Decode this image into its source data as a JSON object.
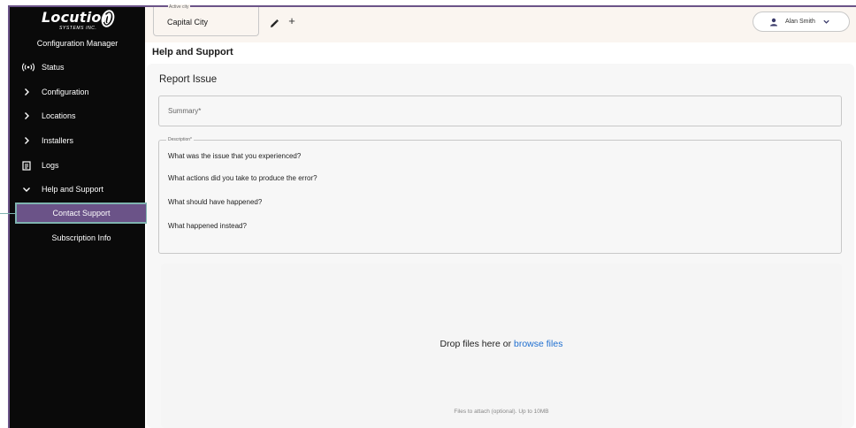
{
  "sidebar": {
    "brand": {
      "word": "Locution",
      "sub": "SYSTEMS INC."
    },
    "app_title": "Configuration Manager",
    "items": [
      {
        "label": "Status",
        "icon": "broadcast-icon"
      },
      {
        "label": "Configuration",
        "icon": "chevron-right-icon"
      },
      {
        "label": "Locations",
        "icon": "chevron-right-icon"
      },
      {
        "label": "Installers",
        "icon": "chevron-right-icon"
      },
      {
        "label": "Logs",
        "icon": "document-icon"
      },
      {
        "label": "Help and Support",
        "icon": "chevron-down-icon"
      }
    ],
    "sub_items": [
      {
        "label": "Contact Support",
        "active": true
      },
      {
        "label": "Subscription Info",
        "active": false
      }
    ]
  },
  "topbar": {
    "city_legend": "Active city",
    "city_value": "Capital City",
    "user_name": "Alan Smith"
  },
  "page": {
    "title": "Help and Support",
    "card_title": "Report Issue",
    "summary_placeholder": "Summary*",
    "description_legend": "Description*",
    "description_lines": [
      "What was the issue that you experienced?",
      "What actions did you take to produce the error?",
      "What should have happened?",
      "What happened instead?"
    ],
    "drop_text": "Drop files here or ",
    "drop_link": "browse files",
    "drop_hint": "Files to attach (optional). Up to 10MB"
  },
  "colors": {
    "accent": "#6b5388",
    "highlight": "#7fb3b0",
    "sidebar_bg": "#0a0a0a",
    "link": "#1f6fd0"
  }
}
